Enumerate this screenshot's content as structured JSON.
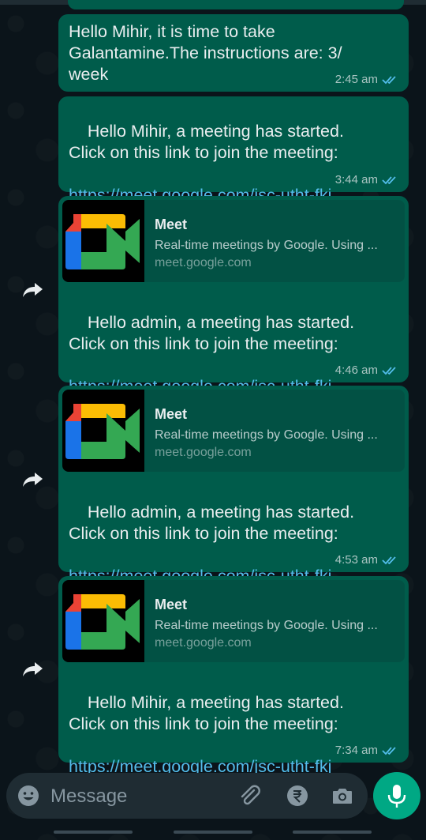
{
  "messages": [
    {
      "text": "Hello Mihir, it is time to take Galantamine.The instructions are: 3/\nweek",
      "time": "2:45 am"
    },
    {
      "text": "Hello Mihir, a meeting has started.\nClick on this link to join the meeting:",
      "link": "https://meet.google.com/jsc-utht-fkj",
      "time": "3:44 am"
    },
    {
      "preview_title": "Meet",
      "preview_desc": "Real-time meetings by Google. Using ...",
      "preview_domain": "meet.google.com",
      "text": "Hello admin, a meeting has started.\nClick on this link to join the meeting:",
      "link": "https://meet.google.com/jsc-utht-fkj",
      "time": "4:46 am"
    },
    {
      "preview_title": "Meet",
      "preview_desc": "Real-time meetings by Google. Using ...",
      "preview_domain": "meet.google.com",
      "text": "Hello admin, a meeting has started.\nClick on this link to join the meeting:",
      "link": "https://meet.google.com/jsc-utht-fkj",
      "time": "4:53 am"
    },
    {
      "preview_title": "Meet",
      "preview_desc": "Real-time meetings by Google. Using ...",
      "preview_domain": "meet.google.com",
      "text": "Hello Mihir, a meeting has started.\nClick on this link to join the meeting:",
      "link": "https://meet.google.com/jsc-utht-fkj",
      "time": "7:34 am"
    }
  ],
  "input": {
    "placeholder": "Message"
  },
  "icons": {
    "emoji": "emoji-icon",
    "attach": "paperclip-icon",
    "payment": "rupee-icon",
    "camera": "camera-icon",
    "mic": "microphone-icon",
    "forward": "forward-icon",
    "ticks": "double-check-icon"
  },
  "colors": {
    "background": "#0b141a",
    "bubble": "#005c4b",
    "preview": "#025144",
    "link": "#53bdeb",
    "tick": "#53bdeb",
    "accent": "#00a884"
  }
}
